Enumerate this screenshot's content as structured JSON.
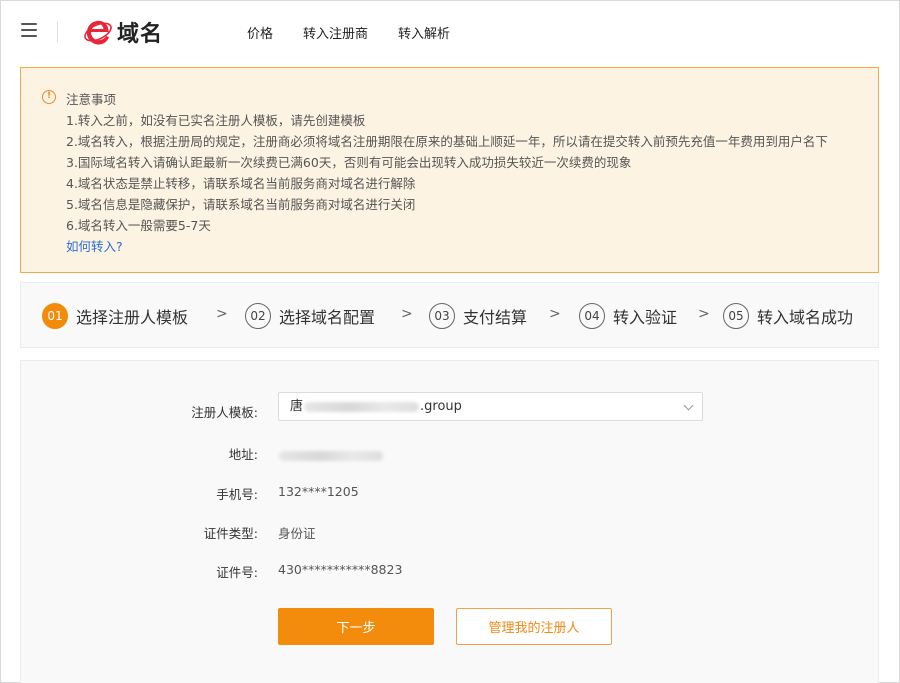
{
  "header": {
    "logo_text": "域名",
    "nav": [
      "价格",
      "转入注册商",
      "转入解析"
    ]
  },
  "notice": {
    "title": "注意事项",
    "items": [
      "1.转入之前，如没有已实名注册人模板，请先创建模板",
      "2.域名转入，根据注册局的规定，注册商必须将域名注册期限在原来的基础上顺延一年，所以请在提交转入前预先充值一年费用到用户名下",
      "3.国际域名转入请确认距最新一次续费已满60天，否则有可能会出现转入成功损失较近一次续费的现象",
      "4.域名状态是禁止转移，请联系域名当前服务商对域名进行解除",
      "5.域名信息是隐藏保护，请联系域名当前服务商对域名进行关闭",
      "6.域名转入一般需要5-7天"
    ],
    "link": "如何转入?"
  },
  "steps": [
    {
      "num": "01",
      "label": "选择注册人模板"
    },
    {
      "num": "02",
      "label": "选择域名配置"
    },
    {
      "num": "03",
      "label": "支付结算"
    },
    {
      "num": "04",
      "label": "转入验证"
    },
    {
      "num": "05",
      "label": "转入域名成功"
    }
  ],
  "step_separator": ">",
  "form": {
    "template_label": "注册人模板:",
    "template_value_prefix": "唐",
    "template_value_suffix": ".group",
    "address_label": "地址:",
    "phone_label": "手机号:",
    "phone_value": "132****1205",
    "id_type_label": "证件类型:",
    "id_type_value": "身份证",
    "id_number_label": "证件号:",
    "id_number_value": "430***********8823"
  },
  "buttons": {
    "next": "下一步",
    "manage": "管理我的注册人"
  },
  "colors": {
    "accent": "#f38c0c",
    "notice_bg": "#fdf3e2",
    "notice_border": "#f3a84a",
    "link": "#2b6fd6"
  }
}
